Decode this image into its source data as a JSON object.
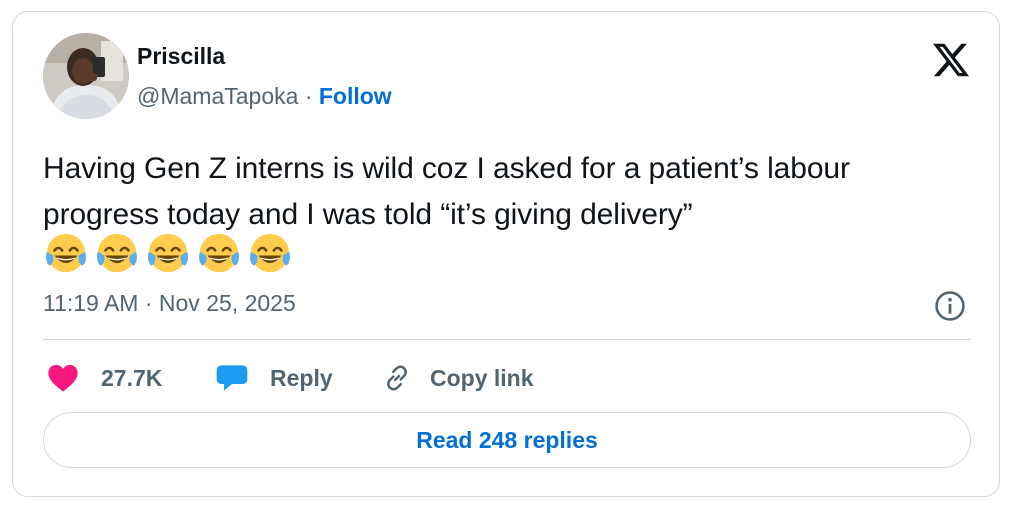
{
  "author": {
    "name": "Priscilla",
    "handle": "@MamaTapoka",
    "separator": "·",
    "follow_label": "Follow"
  },
  "tweet": {
    "text": "Having Gen Z interns is wild coz I asked for a patient’s labour progress today and I was told “it’s giving delivery”",
    "emojis": [
      "face-with-tears-of-joy",
      "face-with-tears-of-joy",
      "face-with-tears-of-joy",
      "face-with-tears-of-joy",
      "face-with-tears-of-joy"
    ],
    "timestamp": "11:19 AM · Nov 25, 2025"
  },
  "actions": {
    "likes_count": "27.7K",
    "reply_label": "Reply",
    "copy_link_label": "Copy link"
  },
  "read_replies_label": "Read 248 replies",
  "colors": {
    "link_blue": "#006fd6",
    "like_pink": "#f91880",
    "reply_blue": "#1d9bf0",
    "secondary_text": "#536471",
    "border": "#cfd9de"
  },
  "icons": [
    "x-logo-icon",
    "info-icon",
    "heart-icon",
    "speech-bubble-icon",
    "link-icon"
  ]
}
